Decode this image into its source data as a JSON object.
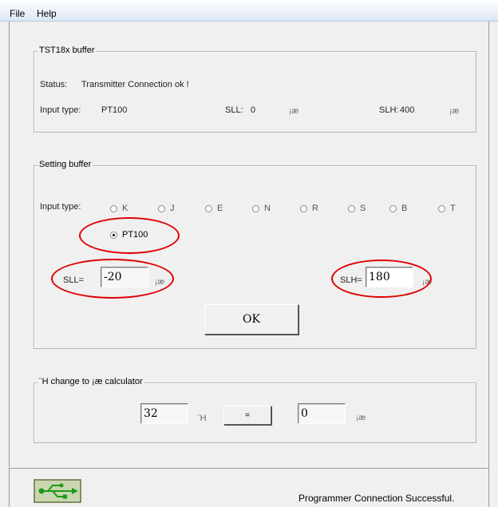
{
  "menu": {
    "file": "File",
    "help": "Help"
  },
  "tst_buffer": {
    "title": "TST18x buffer",
    "status_label": "Status:",
    "status_value": "Transmitter Connection ok !",
    "input_type_label": "Input type:",
    "input_type_value": "PT100",
    "sll_label": "SLL:",
    "sll_value": "0",
    "slh_label": "SLH:",
    "slh_value": "400",
    "unit": "¡æ"
  },
  "setting_buffer": {
    "title": "Setting buffer",
    "input_type_label": "Input type:",
    "options": [
      "K",
      "J",
      "E",
      "N",
      "R",
      "S",
      "B",
      "T"
    ],
    "selected_option": "PT100",
    "sll_label": "SLL=",
    "sll_value": "-20",
    "slh_label": "SLH=",
    "slh_value": "180",
    "unit": "¡æ",
    "ok_label": "OK"
  },
  "calculator": {
    "title": "¨H change to ¡æ calculator",
    "f_value": "32",
    "f_unit": "¨H",
    "equals_label": "=",
    "c_value": "0",
    "c_unit": "¡æ"
  },
  "status_bar": {
    "usb_icon": "usb-icon",
    "message": "Programmer Connection Successful."
  },
  "colors": {
    "annotation": "#e00000",
    "usb": "#1a9a1a"
  }
}
